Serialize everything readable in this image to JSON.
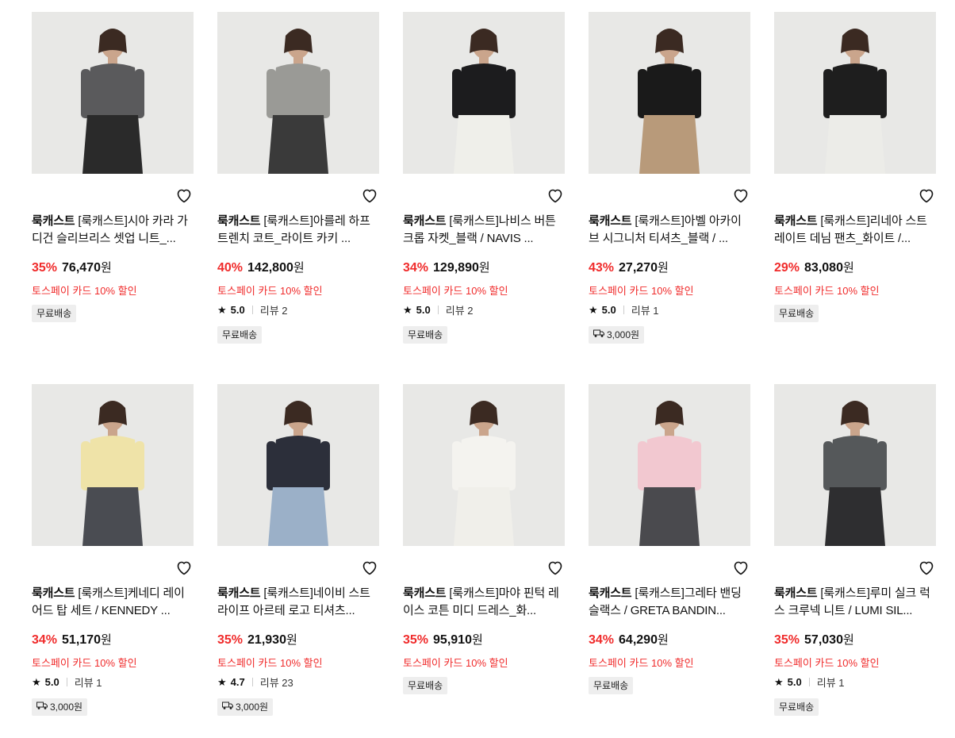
{
  "currency_suffix": "원",
  "colors": {
    "discount": "#f02b2b",
    "benefit": "#f02b2b",
    "tag_bg": "#eeeeee"
  },
  "products": [
    {
      "brand": "룩캐스트",
      "name": "[룩캐스트]시아 카라 가디건 슬리브리스 셋업 니트_...",
      "discount": "35%",
      "price": "76,470",
      "benefit": "토스페이 카드 10% 할인",
      "rating": null,
      "reviews": null,
      "shipping": "무료배송",
      "shipping_type": "free",
      "colors": {
        "top": "#5a5a5c",
        "bottom": "#2a2a2a"
      }
    },
    {
      "brand": "룩캐스트",
      "name": "[룩캐스트]아를레 하프 트렌치 코트_라이트 카키 ...",
      "discount": "40%",
      "price": "142,800",
      "benefit": "토스페이 카드 10% 할인",
      "rating": "5.0",
      "reviews": "리뷰 2",
      "shipping": "무료배송",
      "shipping_type": "free",
      "colors": {
        "top": "#9a9a96",
        "bottom": "#3a3a3a"
      }
    },
    {
      "brand": "룩캐스트",
      "name": "[룩캐스트]나비스 버튼 크롭 자켓_블랙 / NAVIS ...",
      "discount": "34%",
      "price": "129,890",
      "benefit": "토스페이 카드 10% 할인",
      "rating": "5.0",
      "reviews": "리뷰 2",
      "shipping": "무료배송",
      "shipping_type": "free",
      "colors": {
        "top": "#1c1c1e",
        "bottom": "#efefea"
      }
    },
    {
      "brand": "룩캐스트",
      "name": "[룩캐스트]아벨 아카이브 시그니처 티셔츠_블랙 / ...",
      "discount": "43%",
      "price": "27,270",
      "benefit": "토스페이 카드 10% 할인",
      "rating": "5.0",
      "reviews": "리뷰 1",
      "shipping": "3,000원",
      "shipping_type": "paid",
      "colors": {
        "top": "#1a1a1a",
        "bottom": "#b89a7a"
      }
    },
    {
      "brand": "룩캐스트",
      "name": "[룩캐스트]리네아 스트레이트 데님 팬츠_화이트 /...",
      "discount": "29%",
      "price": "83,080",
      "benefit": "토스페이 카드 10% 할인",
      "rating": null,
      "reviews": null,
      "shipping": "무료배송",
      "shipping_type": "free",
      "colors": {
        "top": "#1e1e1e",
        "bottom": "#ecece8"
      }
    },
    {
      "brand": "룩캐스트",
      "name": "[룩캐스트]케네디 레이어드 탑 세트 / KENNEDY ...",
      "discount": "34%",
      "price": "51,170",
      "benefit": "토스페이 카드 10% 할인",
      "rating": "5.0",
      "reviews": "리뷰 1",
      "shipping": "3,000원",
      "shipping_type": "paid",
      "colors": {
        "top": "#efe3a8",
        "bottom": "#4a4c52"
      }
    },
    {
      "brand": "룩캐스트",
      "name": "[룩캐스트]네이비 스트라이프 아르테 로고 티셔츠...",
      "discount": "35%",
      "price": "21,930",
      "benefit": "토스페이 카드 10% 할인",
      "rating": "4.7",
      "reviews": "리뷰 23",
      "shipping": "3,000원",
      "shipping_type": "paid",
      "colors": {
        "top": "#2c2f3a",
        "bottom": "#9bb0c8"
      }
    },
    {
      "brand": "룩캐스트",
      "name": "[룩캐스트]마야 핀턱 레이스 코튼 미디 드레스_화...",
      "discount": "35%",
      "price": "95,910",
      "benefit": "토스페이 카드 10% 할인",
      "rating": null,
      "reviews": null,
      "shipping": "무료배송",
      "shipping_type": "free",
      "colors": {
        "top": "#f4f3ef",
        "bottom": "#f0efea"
      }
    },
    {
      "brand": "룩캐스트",
      "name": "[룩캐스트]그레타 밴딩 슬랙스 / GRETA BANDIN...",
      "discount": "34%",
      "price": "64,290",
      "benefit": "토스페이 카드 10% 할인",
      "rating": null,
      "reviews": null,
      "shipping": "무료배송",
      "shipping_type": "free",
      "colors": {
        "top": "#f2c8d0",
        "bottom": "#4a4a4e"
      }
    },
    {
      "brand": "룩캐스트",
      "name": "[룩캐스트]루미 실크 럭스 크루넥 니트 / LUMI SIL...",
      "discount": "35%",
      "price": "57,030",
      "benefit": "토스페이 카드 10% 할인",
      "rating": "5.0",
      "reviews": "리뷰 1",
      "shipping": "무료배송",
      "shipping_type": "free",
      "colors": {
        "top": "#55585a",
        "bottom": "#2e2e30"
      }
    }
  ]
}
